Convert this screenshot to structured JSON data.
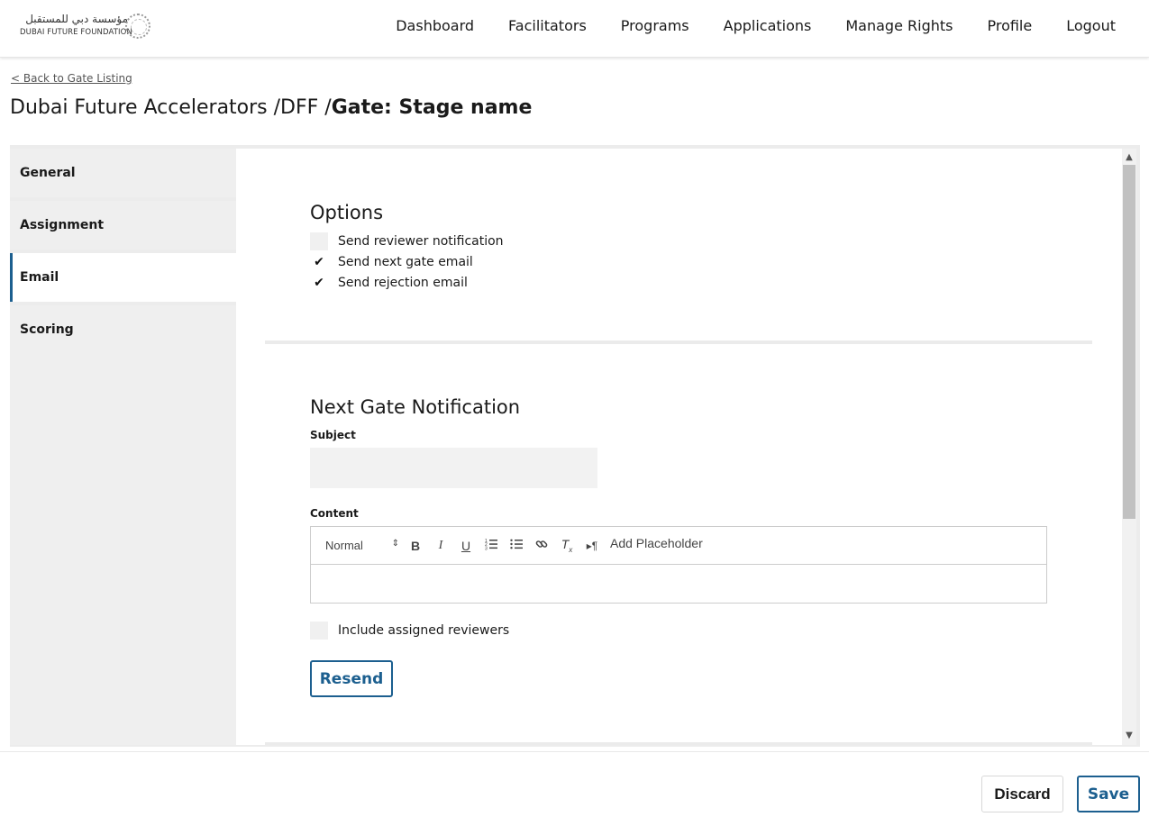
{
  "header": {
    "logo_arabic": "مؤسسة دبي للمستقبل",
    "logo_english": "DUBAI FUTURE FOUNDATION",
    "nav": [
      "Dashboard",
      "Facilitators",
      "Programs",
      "Applications",
      "Manage Rights",
      "Profile",
      "Logout"
    ]
  },
  "back_link": "< Back to Gate Listing",
  "title": {
    "path": "Dubai Future Accelerators /DFF /",
    "current": "Gate: Stage name"
  },
  "sidebar": {
    "items": [
      {
        "label": "General",
        "active": false
      },
      {
        "label": "Assignment",
        "active": false
      },
      {
        "label": "Email",
        "active": true
      },
      {
        "label": "Scoring",
        "active": false
      }
    ]
  },
  "options": {
    "title": "Options",
    "items": [
      {
        "label": "Send reviewer notification",
        "checked": false
      },
      {
        "label": "Send next gate email",
        "checked": true
      },
      {
        "label": "Send rejection email",
        "checked": true
      }
    ]
  },
  "next_gate": {
    "title": "Next Gate Notification",
    "subject_label": "Subject",
    "subject_value": "",
    "content_label": "Content",
    "editor": {
      "format_select": "Normal",
      "add_placeholder": "Add Placeholder",
      "content": ""
    },
    "include_reviewers_label": "Include assigned reviewers",
    "include_reviewers_checked": false,
    "resend_label": "Resend"
  },
  "footer": {
    "discard_label": "Discard",
    "save_label": "Save"
  },
  "colors": {
    "accent": "#1c5f8f",
    "panel": "#efefef"
  }
}
